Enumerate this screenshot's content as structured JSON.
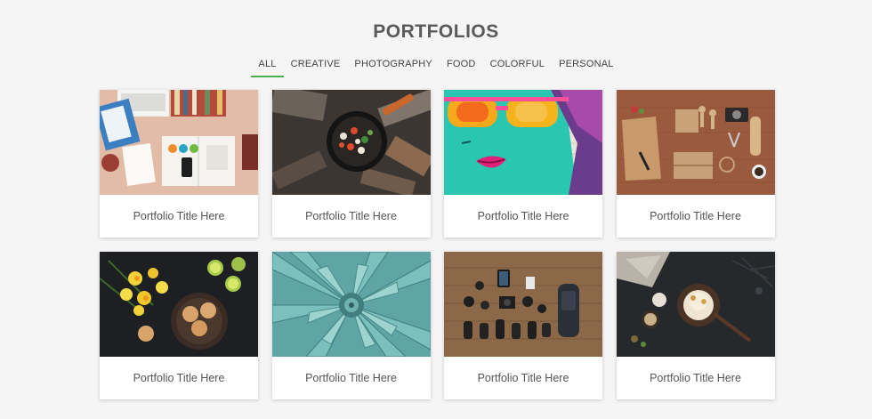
{
  "header": {
    "title": "PORTFOLIOS"
  },
  "filters": [
    {
      "label": "ALL",
      "active": true
    },
    {
      "label": "CREATIVE",
      "active": false
    },
    {
      "label": "PHOTOGRAPHY",
      "active": false
    },
    {
      "label": "FOOD",
      "active": false
    },
    {
      "label": "COLORFUL",
      "active": false
    },
    {
      "label": "PERSONAL",
      "active": false
    }
  ],
  "accent_color": "#4caf50",
  "portfolio": [
    {
      "title": "Portfolio Title Here",
      "image": "desk-workspace-image"
    },
    {
      "title": "Portfolio Title Here",
      "image": "campfire-pan-image"
    },
    {
      "title": "Portfolio Title Here",
      "image": "graffiti-face-image"
    },
    {
      "title": "Portfolio Title Here",
      "image": "craft-tools-image"
    },
    {
      "title": "Portfolio Title Here",
      "image": "daffodils-cookies-image"
    },
    {
      "title": "Portfolio Title Here",
      "image": "succulent-plant-image"
    },
    {
      "title": "Portfolio Title Here",
      "image": "camera-gear-image"
    },
    {
      "title": "Portfolio Title Here",
      "image": "dark-food-table-image"
    }
  ]
}
